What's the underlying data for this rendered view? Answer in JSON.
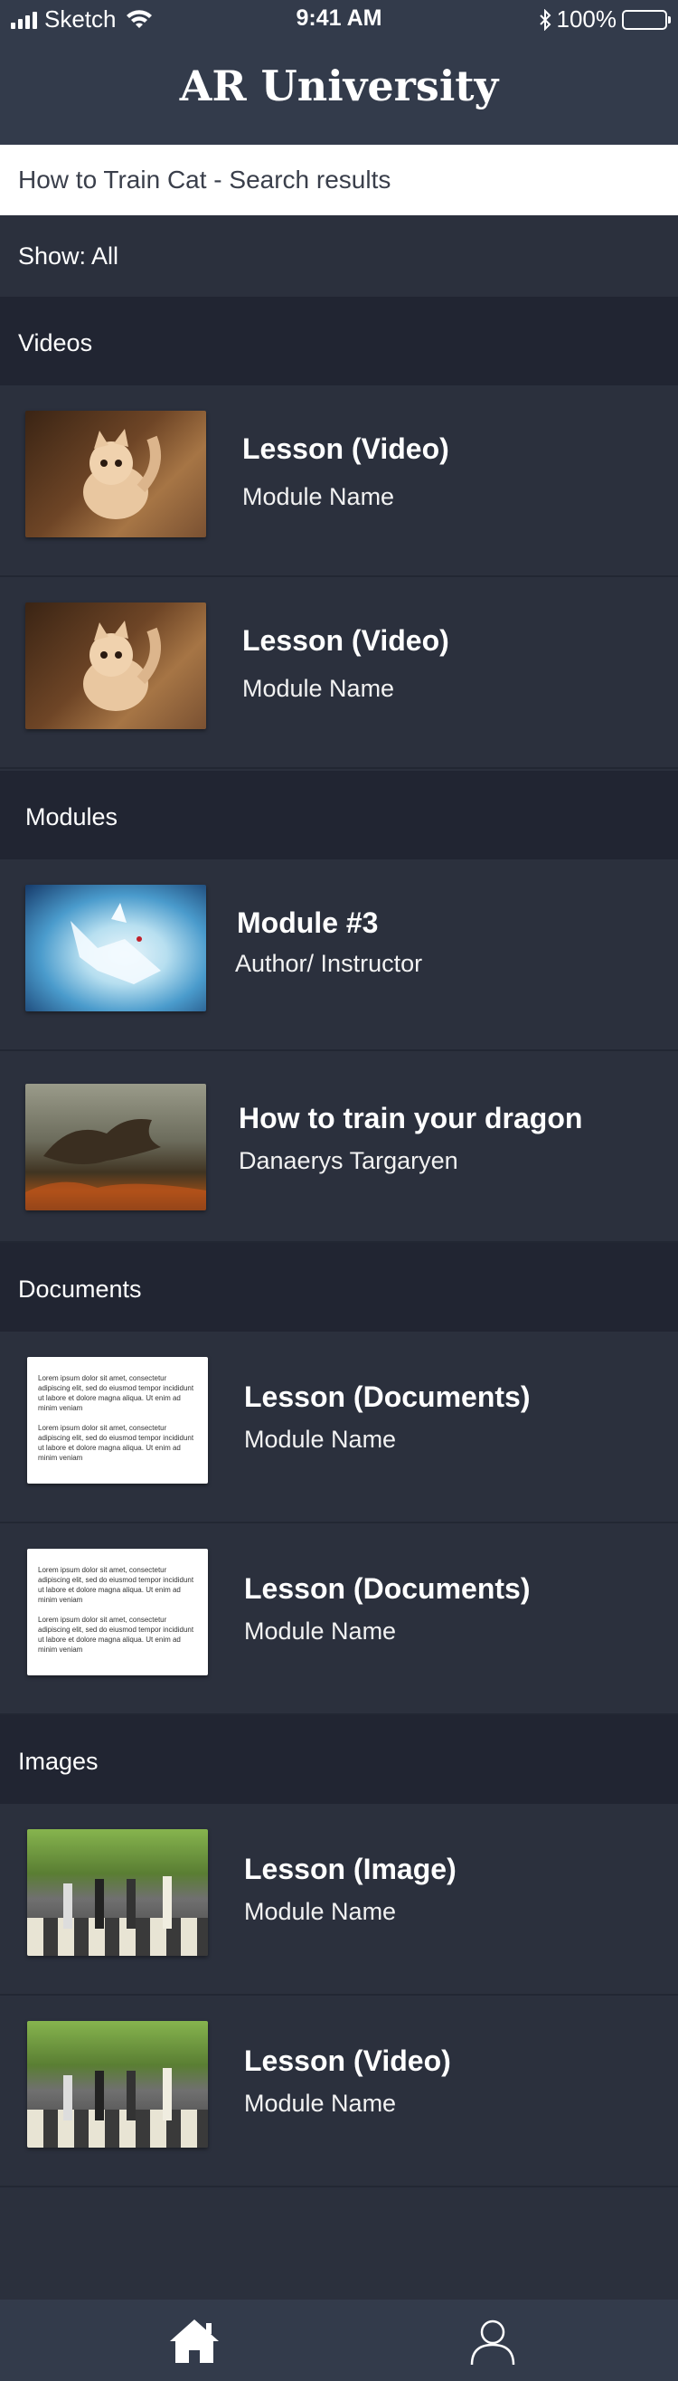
{
  "status_bar": {
    "carrier": "Sketch",
    "time": "9:41 AM",
    "battery": "100%"
  },
  "header": {
    "title": "AR University"
  },
  "search": {
    "value": "How to Train Cat - Search results"
  },
  "filter": {
    "label": "Show: All"
  },
  "sections": {
    "videos": {
      "title": "Videos",
      "items": [
        {
          "title": "Lesson (Video)",
          "subtitle": "Module Name"
        },
        {
          "title": "Lesson (Video)",
          "subtitle": "Module Name"
        }
      ]
    },
    "modules": {
      "title": "Modules",
      "items": [
        {
          "title": "Module #3",
          "subtitle": "Author/ Instructor"
        },
        {
          "title": "How to train your dragon",
          "subtitle": "Danaerys Targaryen"
        }
      ]
    },
    "documents": {
      "title": "Documents",
      "preview_text": [
        "Lorem ipsum dolor sit amet, consectetur adipiscing elit, sed do eiusmod tempor incididunt ut labore et dolore magna aliqua. Ut enim ad minim veniam",
        "Lorem ipsum dolor sit amet, consectetur adipiscing elit, sed do eiusmod tempor incididunt ut labore et dolore magna aliqua. Ut enim ad minim veniam"
      ],
      "items": [
        {
          "title": "Lesson (Documents)",
          "subtitle": "Module Name"
        },
        {
          "title": "Lesson (Documents)",
          "subtitle": "Module Name"
        }
      ]
    },
    "images": {
      "title": "Images",
      "items": [
        {
          "title": "Lesson (Image)",
          "subtitle": "Module Name"
        },
        {
          "title": "Lesson (Video)",
          "subtitle": "Module Name"
        }
      ]
    }
  },
  "tab_bar": {
    "home_icon": "home-icon",
    "profile_icon": "profile-icon"
  },
  "colors": {
    "background": "#2b303d",
    "header": "#333b4b",
    "section_header": "#212532",
    "text": "#ffffff"
  }
}
